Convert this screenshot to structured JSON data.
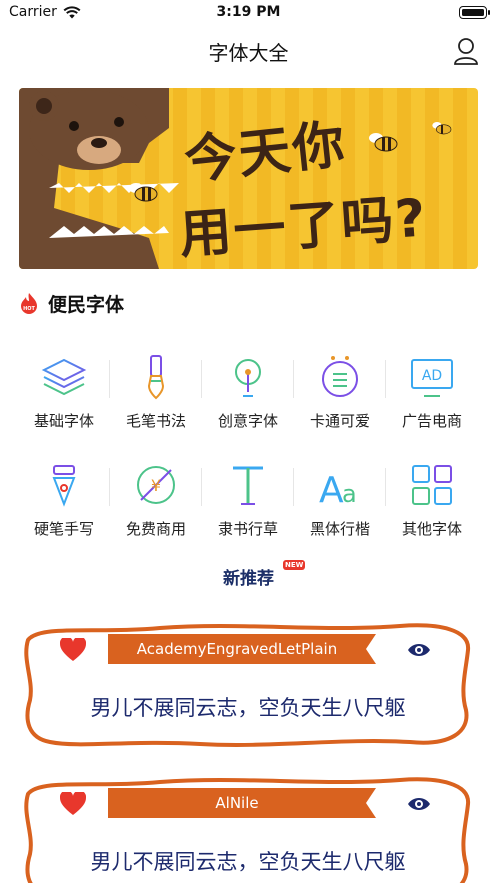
{
  "status_bar": {
    "carrier": "Carrier",
    "time": "3:19 PM"
  },
  "nav": {
    "title": "字体大全"
  },
  "banner": {
    "line1": "今天你",
    "line2": "用一了吗?"
  },
  "section": {
    "badge": "HOT",
    "title": "便民字体"
  },
  "categories": [
    {
      "label": "基础字体",
      "icon": "layers-icon"
    },
    {
      "label": "毛笔书法",
      "icon": "brush-icon"
    },
    {
      "label": "创意字体",
      "icon": "lightbulb-icon"
    },
    {
      "label": "卡通可爱",
      "icon": "cartoon-face-icon"
    },
    {
      "label": "广告电商",
      "icon": "ad-monitor-icon"
    },
    {
      "label": "硬笔手写",
      "icon": "pen-nib-icon"
    },
    {
      "label": "免费商用",
      "icon": "free-yuan-icon"
    },
    {
      "label": "隶书行草",
      "icon": "text-t-icon"
    },
    {
      "label": "黑体行楷",
      "icon": "font-aa-icon"
    },
    {
      "label": "其他字体",
      "icon": "grid-apps-icon"
    }
  ],
  "recommend": {
    "title": "新推荐",
    "badge": "NEW"
  },
  "fonts": [
    {
      "name": "AcademyEngravedLetPlain",
      "sample": "男儿不展同云志，空负天生八尺躯"
    },
    {
      "name": "AlNile",
      "sample": "男儿不展同云志，空负天生八尺躯"
    }
  ],
  "colors": {
    "accent": "#d9621f",
    "nav_text": "#1c2f68",
    "banner_bg": "#f6c531",
    "heart": "#e8372c"
  }
}
